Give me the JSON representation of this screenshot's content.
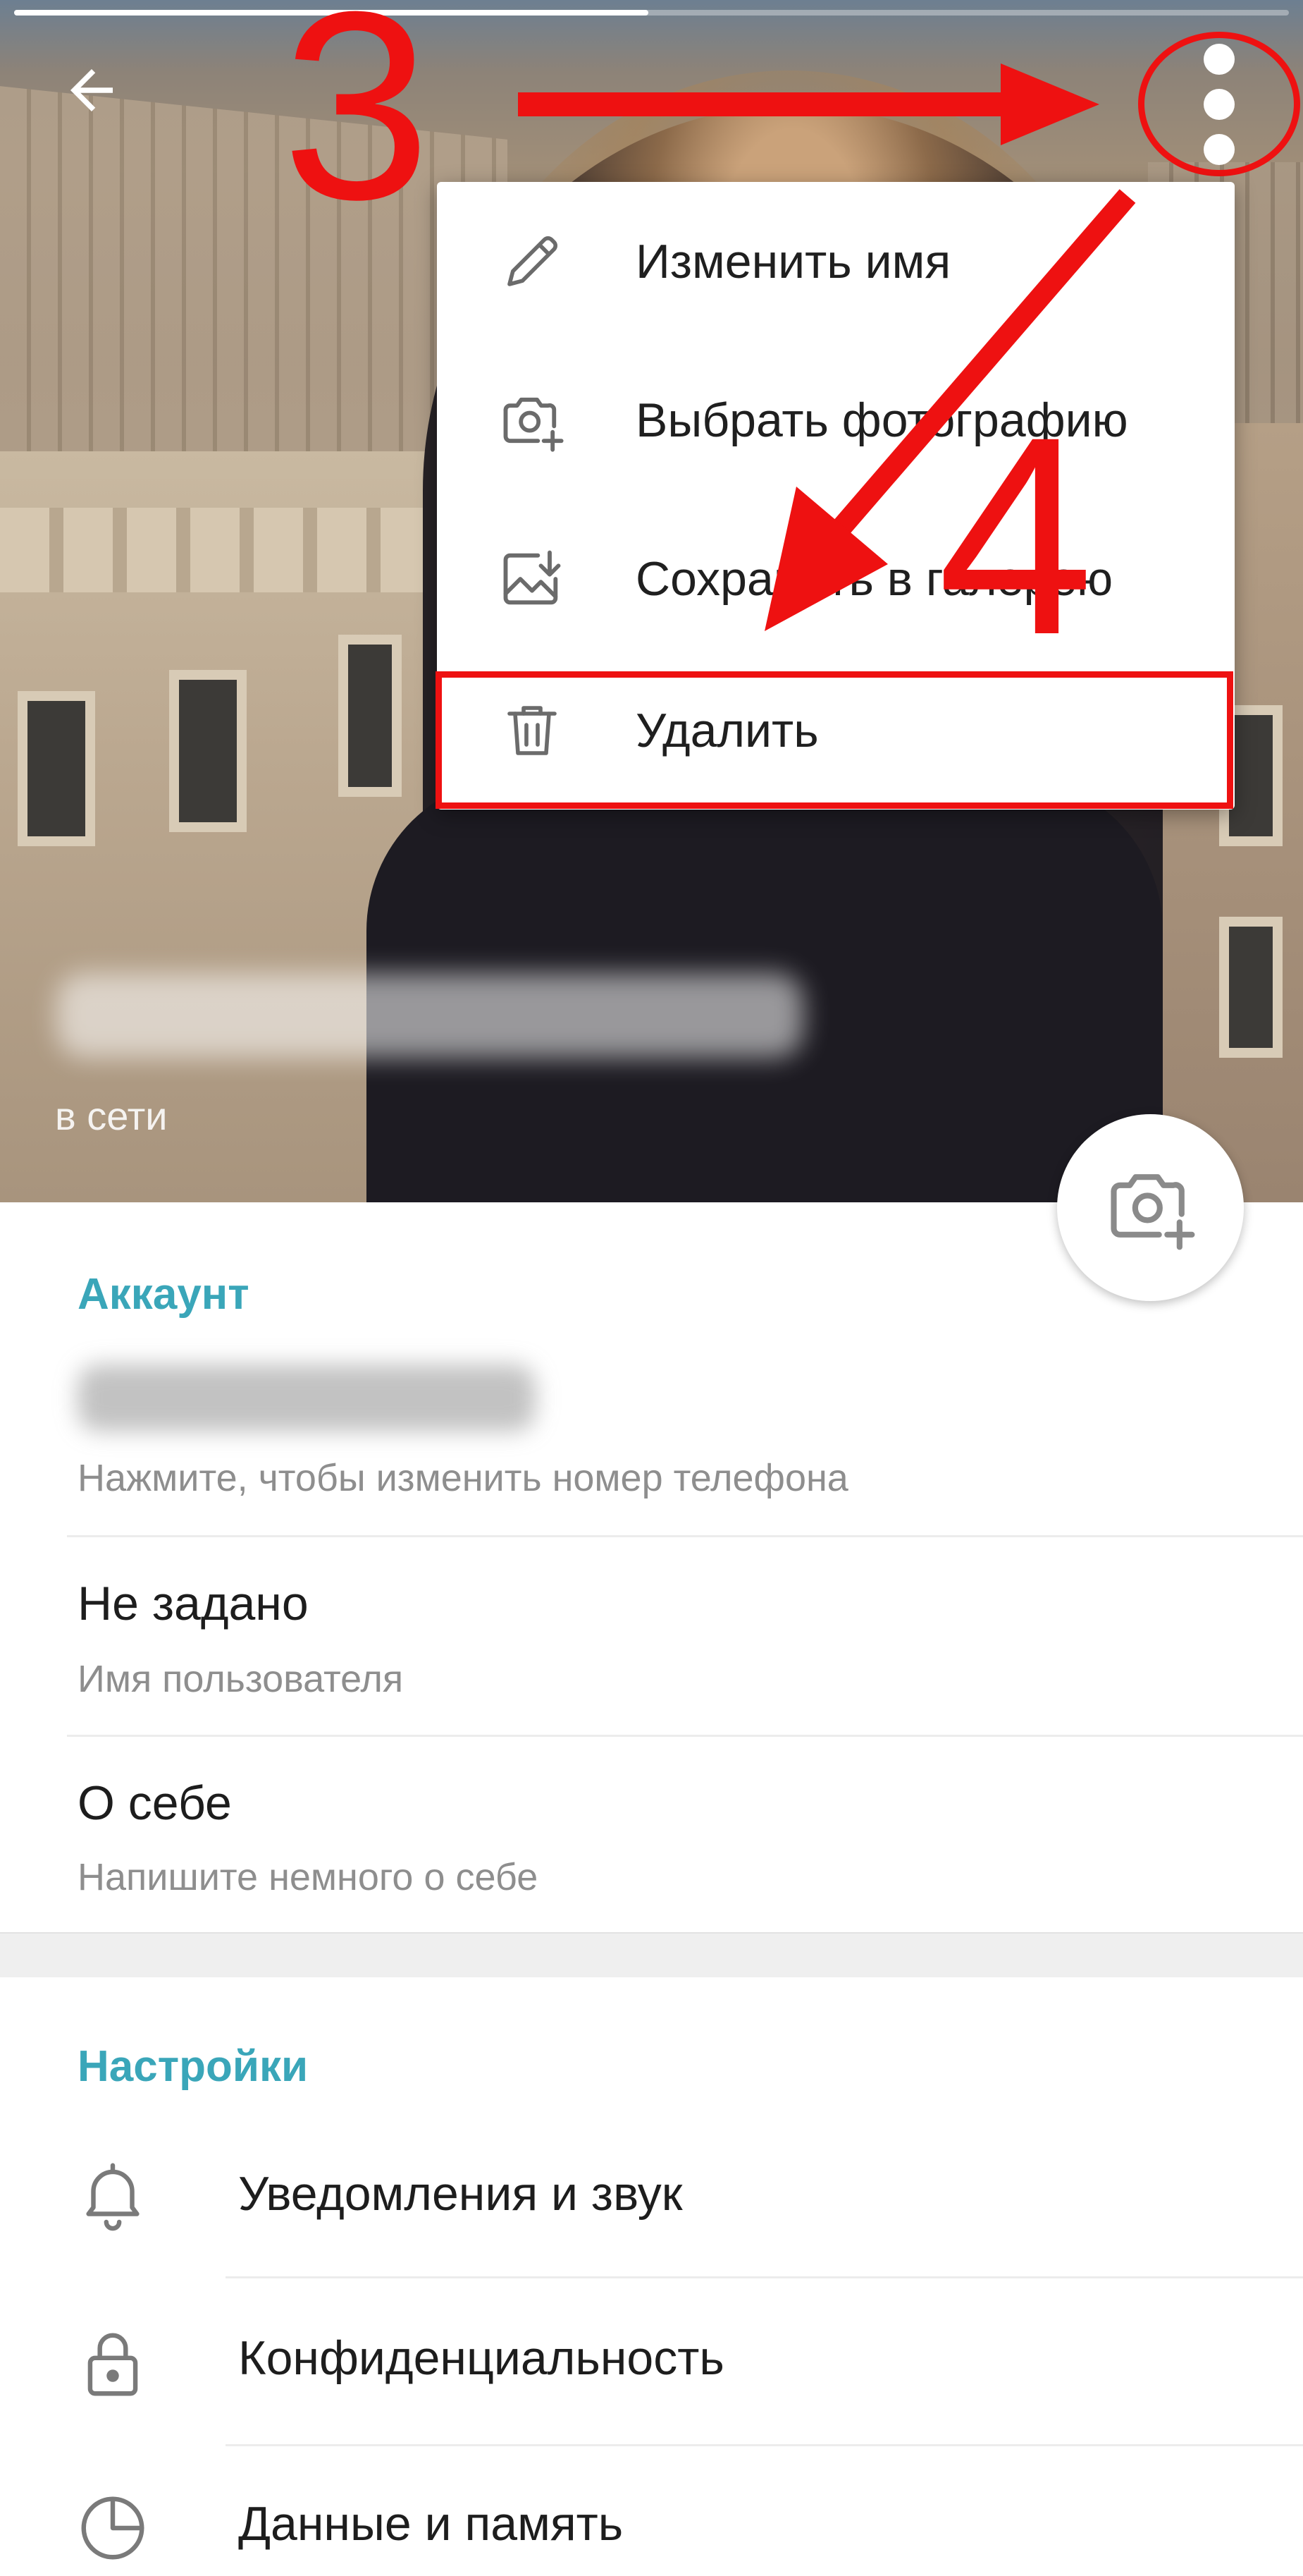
{
  "header": {
    "status": "в сети",
    "back_icon": "arrow-left-icon",
    "more_icon": "more-vertical-icon",
    "camera_icon": "camera-add-icon"
  },
  "menu": {
    "items": [
      {
        "label": "Изменить имя",
        "icon": "pencil-icon"
      },
      {
        "label": "Выбрать фотографию",
        "icon": "camera-add-icon"
      },
      {
        "label": "Сохранить в галерею",
        "icon": "save-image-icon"
      },
      {
        "label": "Удалить",
        "icon": "trash-icon"
      }
    ]
  },
  "annotations": {
    "step3": "3",
    "step4": "4",
    "color": "#ee1111"
  },
  "account": {
    "title": "Аккаунт",
    "phone_hint": "Нажмите, чтобы изменить номер телефона",
    "username_value": "Не задано",
    "username_hint": "Имя пользователя",
    "bio_value": "О себе",
    "bio_hint": "Напишите немного о себе"
  },
  "settings": {
    "title": "Настройки",
    "items": [
      {
        "label": "Уведомления и звук",
        "icon": "bell-icon"
      },
      {
        "label": "Конфиденциальность",
        "icon": "lock-icon"
      },
      {
        "label": "Данные и память",
        "icon": "clock-icon"
      }
    ]
  },
  "colors": {
    "accent": "#3aa6b9",
    "annotation": "#ee1111",
    "secondary_text": "#8e8e8e"
  }
}
